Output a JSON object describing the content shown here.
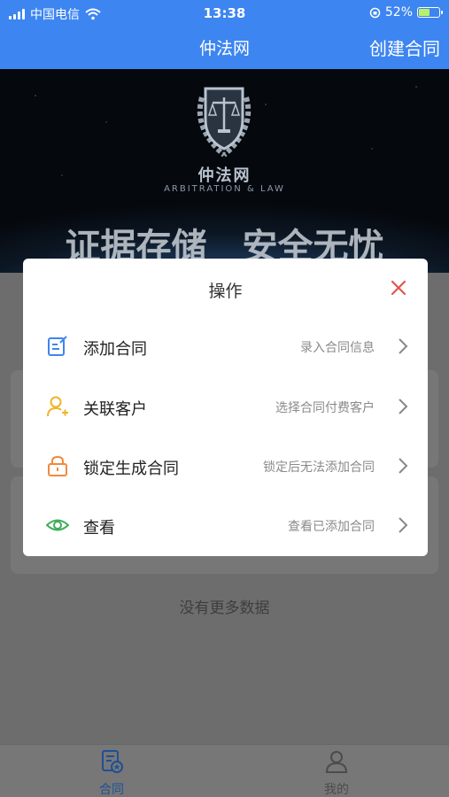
{
  "status_bar": {
    "carrier": "中国电信",
    "time": "13:38",
    "battery": "52%"
  },
  "nav": {
    "title": "仲法网",
    "action": "创建合同"
  },
  "banner": {
    "brand": "仲法网",
    "brand_en": "ARBITRATION & LAW",
    "slogan_left": "证据存储",
    "slogan_right": "安全无忧"
  },
  "list": {
    "no_more": "没有更多数据"
  },
  "modal": {
    "title": "操作",
    "items": [
      {
        "name": "添加合同",
        "desc": "录入合同信息",
        "icon": "edit-document-icon",
        "color": "#3d85f0"
      },
      {
        "name": "关联客户",
        "desc": "选择合同付费客户",
        "icon": "user-add-icon",
        "color": "#f0b429"
      },
      {
        "name": "锁定生成合同",
        "desc": "锁定后无法添加合同",
        "icon": "lock-icon",
        "color": "#f08a3c"
      },
      {
        "name": "查看",
        "desc": "查看已添加合同",
        "icon": "eye-icon",
        "color": "#3fae5c"
      }
    ]
  },
  "tabs": [
    {
      "label": "合同",
      "icon": "contract-icon",
      "active": true
    },
    {
      "label": "我的",
      "icon": "user-icon",
      "active": false
    }
  ]
}
